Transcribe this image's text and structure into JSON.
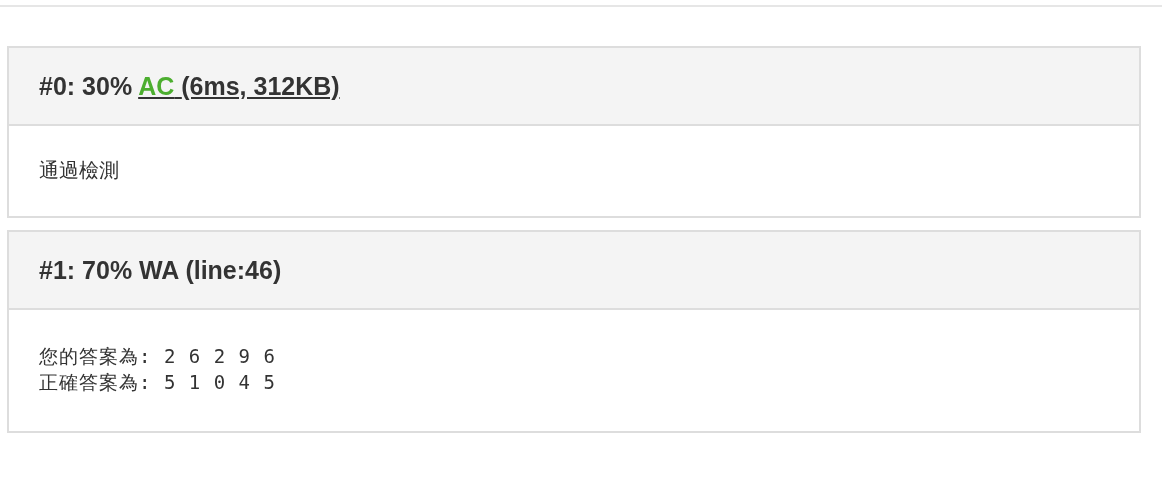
{
  "results": [
    {
      "label": "#0: 30%",
      "verdict": "AC",
      "color": "#4cae2f",
      "detail": "(6ms, 312KB)",
      "linked": true,
      "body": {
        "kind": "message",
        "lines": [
          "通過檢測"
        ]
      }
    },
    {
      "label": "#1: 70%",
      "verdict": "WA",
      "color": "#333333",
      "detail": "(line:46)",
      "linked": false,
      "body": {
        "kind": "output",
        "lines": [
          "您的答案為: 2 6 2 9 6",
          "正確答案為: 5 1 0 4 5"
        ]
      }
    }
  ]
}
